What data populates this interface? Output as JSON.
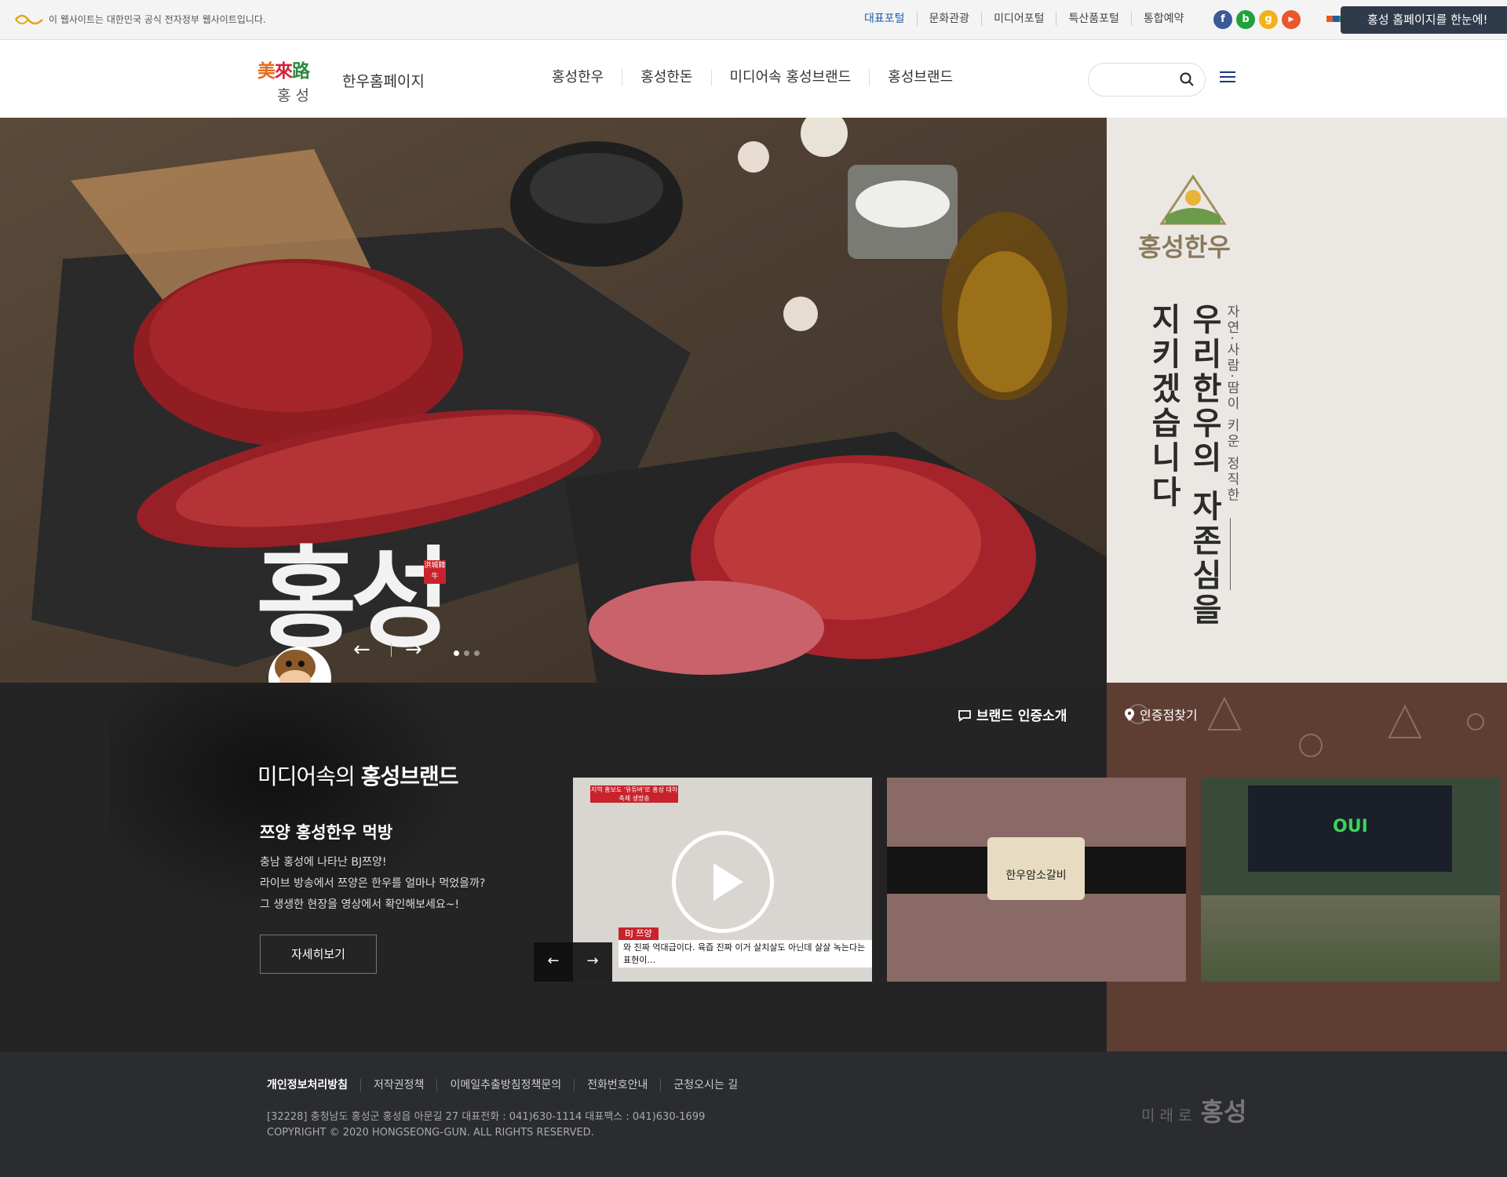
{
  "util": {
    "gov_text": "이 웹사이트는 대한민국 공식 전자정부 웹사이트입니다.",
    "portals": [
      "대표포털",
      "문화관광",
      "미디어포털",
      "특산품포털",
      "통합예약"
    ],
    "sns": [
      "f",
      "b",
      "g",
      "▶"
    ],
    "one_page_button": "홍성 홈페이지를 한눈에!"
  },
  "header": {
    "logo_cn": [
      "美",
      "來",
      "路"
    ],
    "logo_kr": "홍 성",
    "site_name": "한우홈페이지",
    "gnb": [
      "홍성한우",
      "홍성한돈",
      "미디어속 홍성브랜드",
      "홍성브랜드"
    ],
    "search_placeholder": ""
  },
  "hero": {
    "vertical_1": "지키겠습니다",
    "vertical_2": "우리한우의 자존심을",
    "vertical_3": "자연·사람·땀이 키운 정직한",
    "brand_name": "홍성한우",
    "big_text": "홍성",
    "seal_text": "洪城韓牛",
    "slide_count": 3,
    "active_slide": 1
  },
  "media": {
    "brand_intro": "브랜드 인증소개",
    "find_store": "인증점찾기",
    "title_light": "미디어속의 ",
    "title_bold": "홍성브랜드",
    "sub_title": "쯔양 홍성한우 먹방",
    "desc_lines": [
      "충남 홍성에 나타난 BJ쯔양!",
      "라이브 방송에서 쯔양은 한우를 얼마나 먹었을까?",
      "그 생생한 현장을 영상에서 확인해보세요~!"
    ],
    "more_button": "자세히보기",
    "thumb1_badge": "지역 홍보도 '유튜버'로 홍성 대하축제 생방송",
    "thumb1_tag": "BJ 쯔양",
    "thumb1_caption": "와 진짜 억대급이다. 육즙 진짜 이거 살치살도 아닌데 살살 녹는다는 표현이…",
    "thumb2_label": "한우암소갈비",
    "thumb3_sign": "OUI"
  },
  "footer": {
    "links": [
      "개인정보처리방침",
      "저작권정책",
      "이메일추출방침정책문의",
      "전화번호안내",
      "군청오시는 길"
    ],
    "address": "[32228] 충청남도 홍성군 홍성읍 아문길 27 대표전화 : 041)630-1114 대표팩스 : 041)630-1699",
    "copyright": "COPYRIGHT © 2020 HONGSEONG-GUN. ALL RIGHTS RESERVED.",
    "logo_small": "미래로",
    "logo_big": "홍성"
  },
  "colors": {
    "accent_blue": "#1a5fa8",
    "dark_bg": "#242424",
    "brown_bg": "#5e3e33",
    "footer_bg": "#2a2c30",
    "hero_side_bg": "#ebe8e4"
  }
}
